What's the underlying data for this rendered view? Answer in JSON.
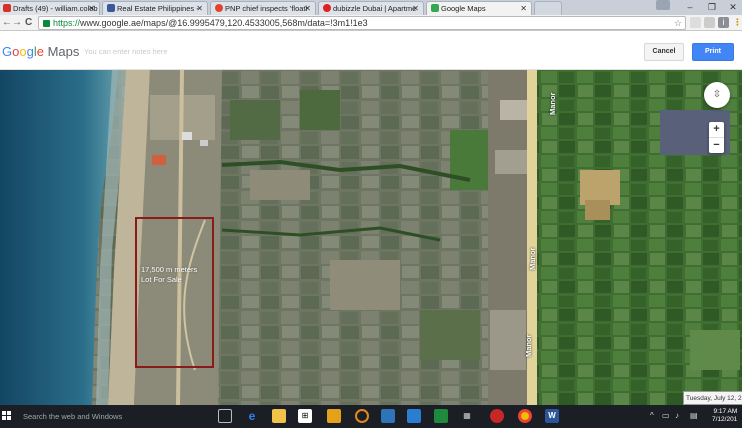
{
  "browser": {
    "tabs": [
      {
        "label": "Drafts (49) - william.colob",
        "color": "#d93025"
      },
      {
        "label": "Real Estate Philippines -",
        "color": "#3b5998"
      },
      {
        "label": "PNP chief inspects 'floati",
        "color": "#e0442d"
      },
      {
        "label": "dubizzle Dubai | Apartme",
        "color": "#e02020"
      },
      {
        "label": "Google Maps",
        "color": "#34a853"
      }
    ],
    "url_https": "https://",
    "url_rest": "www.google.ae/maps/@16.9995479,120.4533005,568m/data=!3m1!1e3"
  },
  "print_header": {
    "logo_google": "Google",
    "logo_maps": "Maps",
    "notes_placeholder": "You can enter notes here",
    "cancel_label": "Cancel",
    "print_label": "Print"
  },
  "map": {
    "annotation_line1": "17,500 m meters",
    "annotation_line2": "Lot For Sale",
    "road_labels": [
      "Manor",
      "Manor",
      "Manor"
    ],
    "date_tooltip": "Tuesday, July 12, 2",
    "zoom_in": "+",
    "zoom_out": "−"
  },
  "taskbar": {
    "search_placeholder": "Search the web and Windows",
    "time": "9:17 AM",
    "date": "7/12/201"
  },
  "colors": {
    "accent_blue": "#4285f4",
    "lot_outline": "#8b1a1a",
    "ocean": "#1b4f6e",
    "beach": "#bfb59a",
    "road": "#d9c98e"
  }
}
